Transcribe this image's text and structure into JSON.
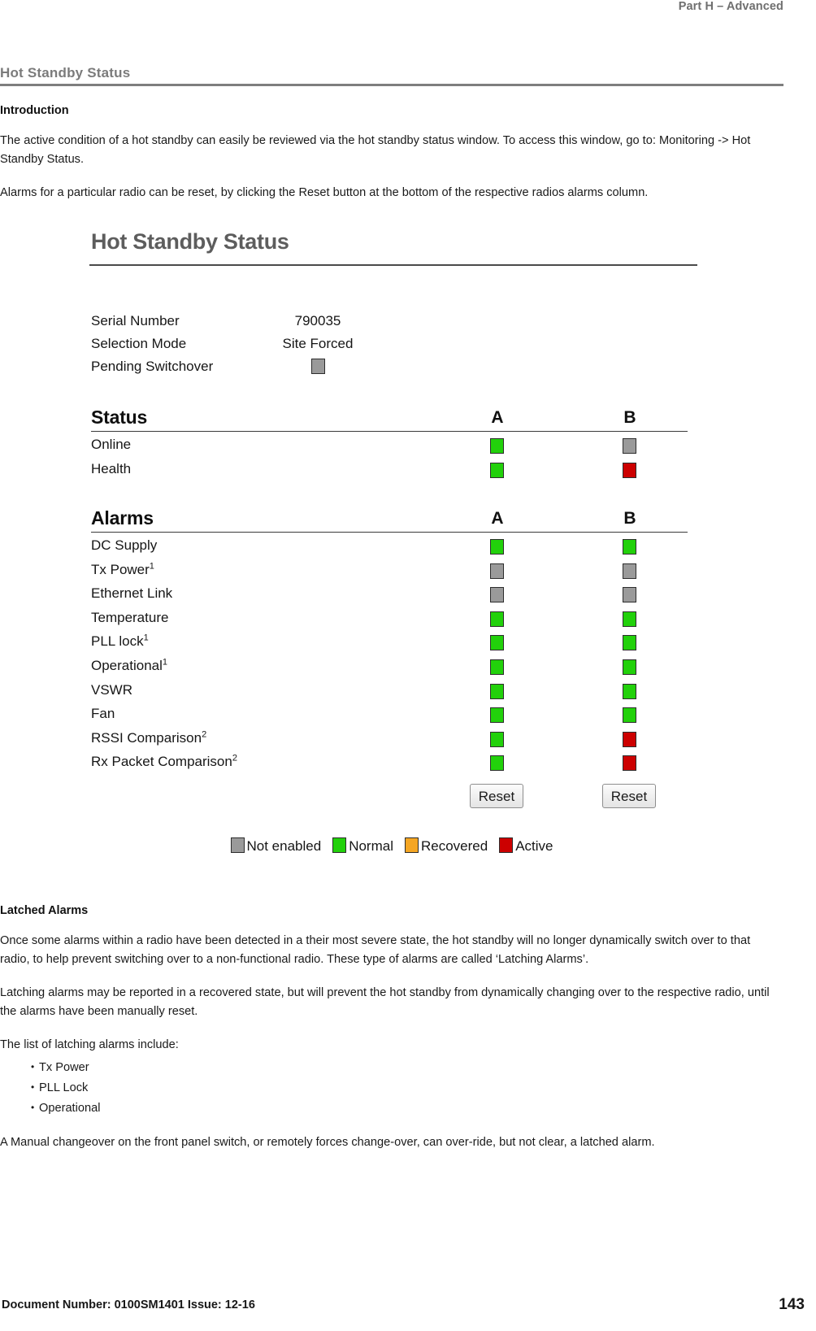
{
  "header": {
    "running_head": "Part H – Advanced"
  },
  "chapter": {
    "title": "Hot Standby Status"
  },
  "intro": {
    "heading": "Introduction",
    "paragraph_1": "The active condition of a hot standby can easily be reviewed via the hot standby status window. To access this window, go to: Monitoring -> Hot Standby Status.",
    "paragraph_2": "Alarms for a particular radio can be reset, by clicking the Reset button at the bottom of the respective radios alarms column."
  },
  "screenshot": {
    "title": "Hot Standby Status",
    "info": {
      "serial_number_label": "Serial Number",
      "serial_number_value": "790035",
      "selection_mode_label": "Selection Mode",
      "selection_mode_value": "Site Forced",
      "pending_switchover_label": "Pending Switchover",
      "pending_switchover_state": "not-enabled"
    },
    "status_table": {
      "title": "Status",
      "col_a": "A",
      "col_b": "B",
      "rows": [
        {
          "label": "Online",
          "a": "green",
          "b": "gray"
        },
        {
          "label": "Health",
          "a": "green",
          "b": "red"
        }
      ]
    },
    "alarms_table": {
      "title": "Alarms",
      "col_a": "A",
      "col_b": "B",
      "rows": [
        {
          "label": "DC Supply",
          "sup": "",
          "a": "green",
          "b": "green"
        },
        {
          "label": "Tx Power",
          "sup": "1",
          "a": "gray",
          "b": "gray"
        },
        {
          "label": "Ethernet Link",
          "sup": "",
          "a": "gray",
          "b": "gray"
        },
        {
          "label": "Temperature",
          "sup": "",
          "a": "green",
          "b": "green"
        },
        {
          "label": "PLL lock",
          "sup": "1",
          "a": "green",
          "b": "green"
        },
        {
          "label": "Operational",
          "sup": "1",
          "a": "green",
          "b": "green"
        },
        {
          "label": "VSWR",
          "sup": "",
          "a": "green",
          "b": "green"
        },
        {
          "label": "Fan",
          "sup": "",
          "a": "green",
          "b": "green"
        },
        {
          "label": "RSSI Comparison",
          "sup": "2",
          "a": "green",
          "b": "red"
        },
        {
          "label": "Rx Packet Comparison",
          "sup": "2",
          "a": "green",
          "b": "red"
        }
      ]
    },
    "reset_a_label": "Reset",
    "reset_b_label": "Reset",
    "legend": [
      {
        "label": "Not enabled",
        "color": "#9a9a9a"
      },
      {
        "label": "Normal",
        "color": "#22d10b"
      },
      {
        "label": "Recovered",
        "color": "#f5a623"
      },
      {
        "label": "Active",
        "color": "#cc0000"
      }
    ]
  },
  "latched": {
    "heading": "Latched Alarms",
    "paragraph_1": "Once some alarms within a radio have been detected in a their most severe state, the hot standby will no longer dynamically switch over to that radio, to help prevent switching over to a non-functional radio. These type of alarms are called ‘Latching Alarms’.",
    "paragraph_2": "Latching alarms may be reported in a recovered state, but will prevent the hot standby from dynamically changing over to the respective radio, until the alarms have been manually reset.",
    "list_intro": "The list of latching alarms include:",
    "list_items": [
      "Tx Power",
      "PLL Lock",
      "Operational"
    ],
    "paragraph_3": "A Manual changeover on the front panel switch, or remotely forces change-over, can over-ride, but not clear, a latched alarm."
  },
  "footer": {
    "document": "Document Number: 0100SM1401   Issue: 12-16",
    "page_number": "143"
  }
}
